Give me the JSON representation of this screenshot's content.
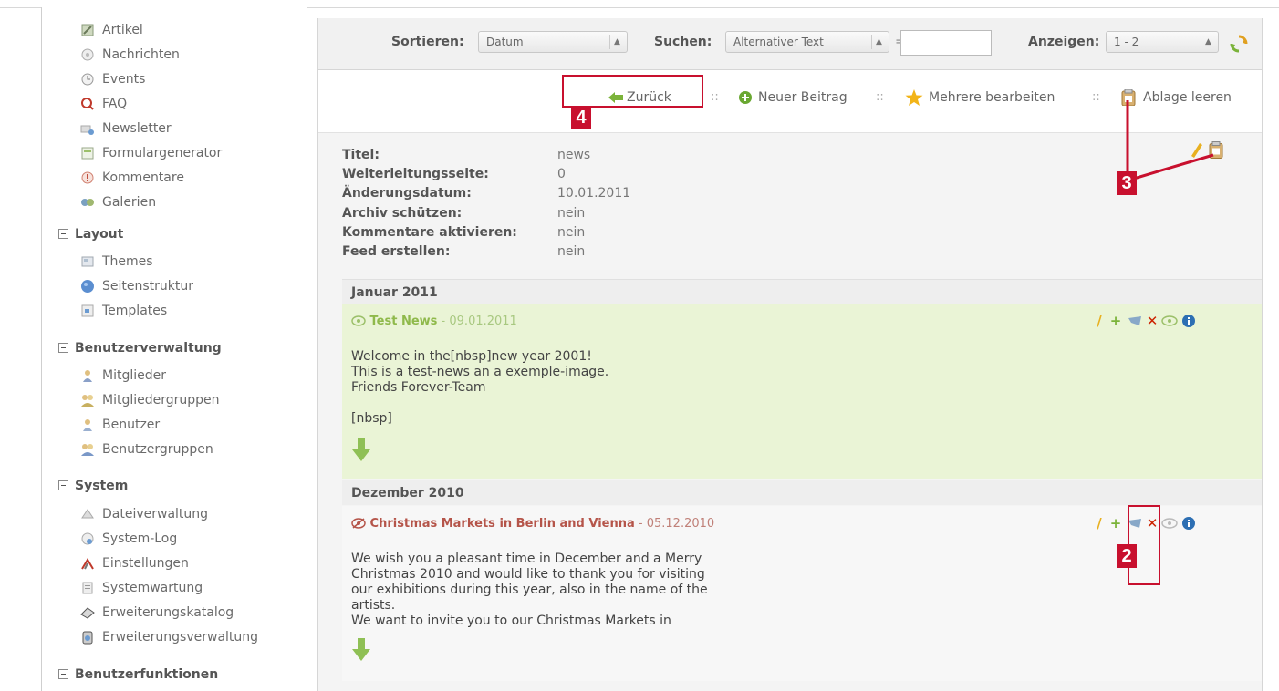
{
  "sidebar": {
    "items_top": [
      {
        "label": "Artikel",
        "icon": "article-icon"
      },
      {
        "label": "Nachrichten",
        "icon": "news-icon"
      },
      {
        "label": "Events",
        "icon": "events-icon"
      },
      {
        "label": "FAQ",
        "icon": "faq-icon"
      },
      {
        "label": "Newsletter",
        "icon": "newsletter-icon"
      },
      {
        "label": "Formulargenerator",
        "icon": "form-generator-icon"
      },
      {
        "label": "Kommentare",
        "icon": "comments-icon"
      },
      {
        "label": "Galerien",
        "icon": "galleries-icon"
      }
    ],
    "sections": [
      {
        "title": "Layout",
        "items": [
          {
            "label": "Themes",
            "icon": "themes-icon"
          },
          {
            "label": "Seitenstruktur",
            "icon": "site-structure-icon"
          },
          {
            "label": "Templates",
            "icon": "templates-icon"
          }
        ]
      },
      {
        "title": "Benutzerverwaltung",
        "items": [
          {
            "label": "Mitglieder",
            "icon": "member-icon"
          },
          {
            "label": "Mitgliedergruppen",
            "icon": "member-groups-icon"
          },
          {
            "label": "Benutzer",
            "icon": "user-icon"
          },
          {
            "label": "Benutzergruppen",
            "icon": "user-groups-icon"
          }
        ]
      },
      {
        "title": "System",
        "items": [
          {
            "label": "Dateiverwaltung",
            "icon": "file-manager-icon"
          },
          {
            "label": "System-Log",
            "icon": "system-log-icon"
          },
          {
            "label": "Einstellungen",
            "icon": "settings-icon"
          },
          {
            "label": "Systemwartung",
            "icon": "maintenance-icon"
          },
          {
            "label": "Erweiterungskatalog",
            "icon": "extension-catalog-icon"
          },
          {
            "label": "Erweiterungsverwaltung",
            "icon": "extension-manager-icon"
          }
        ]
      },
      {
        "title": "Benutzerfunktionen",
        "items": []
      }
    ]
  },
  "toolbar": {
    "sort_label": "Sortieren:",
    "sort_value": "Datum",
    "search_label": "Suchen:",
    "search_field": "Alternativer Text",
    "equals": "=",
    "search_value": "",
    "show_label": "Anzeigen:",
    "show_value": "1 - 2"
  },
  "actions": {
    "back": "Zurück",
    "new_post": "Neuer Beitrag",
    "edit_multiple": "Mehrere bearbeiten",
    "clear_clipboard": "Ablage leeren",
    "separator": "::"
  },
  "archive_info": [
    {
      "key": "Titel:",
      "value": "news"
    },
    {
      "key": "Weiterleitungsseite:",
      "value": "0"
    },
    {
      "key": "Änderungsdatum:",
      "value": "10.01.2011"
    },
    {
      "key": "Archiv schützen:",
      "value": "nein"
    },
    {
      "key": "Kommentare aktivieren:",
      "value": "nein"
    },
    {
      "key": "Feed erstellen:",
      "value": "nein"
    }
  ],
  "groups": [
    {
      "month": "Januar 2011",
      "entry": {
        "title": "Test News",
        "date": "09.01.2011",
        "title_color": "#8fb94b",
        "body": "Welcome in the[nbsp]new year 2001!\nThis is a test-news an a exemple-image.\nFriends Forever-Team\n\n[nbsp]"
      }
    },
    {
      "month": "Dezember 2010",
      "entry": {
        "title": "Christmas Markets in Berlin and Vienna",
        "date": "05.12.2010",
        "title_color": "#b5554a",
        "body": "We wish you a pleasant time in December and a Merry\nChristmas 2010 and would like to thank you for visiting\nour exhibitions during this year, also in the name of the\nartists.\nWe want to invite you to our Christmas Markets in"
      }
    }
  ],
  "callouts": [
    "4",
    "3",
    "2"
  ],
  "colors": {
    "accent_red": "#c8102e",
    "green_bg": "#eaf4d6",
    "edit_yellow": "#e8b020",
    "delete_red": "#cc2200",
    "add_green": "#7bb33a",
    "info_blue": "#2d6fb3"
  }
}
